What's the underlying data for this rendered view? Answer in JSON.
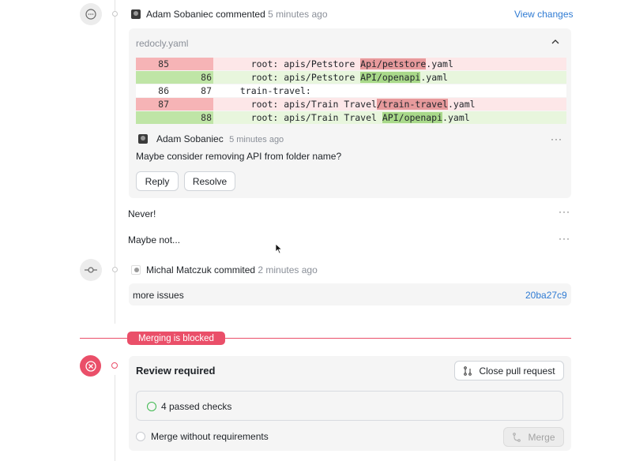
{
  "comment_event": {
    "author": "Adam Sobaniec",
    "action": "commented",
    "time": "5 minutes ago",
    "view_changes": "View changes"
  },
  "diff": {
    "filename": "redocly.yaml",
    "rows": [
      {
        "type": "del",
        "old": "85",
        "new": "",
        "prefix": "    root: apis/Petstore ",
        "highlight": "Api/petstore",
        "suffix": ".yaml"
      },
      {
        "type": "add",
        "old": "",
        "new": "86",
        "prefix": "    root: apis/Petstore ",
        "highlight": "API/openapi",
        "suffix": ".yaml"
      },
      {
        "type": "ctx",
        "old": "86",
        "new": "87",
        "prefix": "  train-travel:",
        "highlight": "",
        "suffix": ""
      },
      {
        "type": "del",
        "old": "87",
        "new": "",
        "prefix": "    root: apis/Train Travel",
        "highlight": "/train-travel",
        "suffix": ".yaml"
      },
      {
        "type": "add",
        "old": "",
        "new": "88",
        "prefix": "    root: apis/Train Travel ",
        "highlight": "API/openapi",
        "suffix": ".yaml"
      }
    ]
  },
  "review_comment": {
    "author": "Adam Sobaniec",
    "time": "5 minutes ago",
    "more": "···",
    "body": "Maybe consider removing API from folder name?",
    "reply": "Reply",
    "resolve": "Resolve"
  },
  "replies": [
    {
      "text": "Never!",
      "more": "···"
    },
    {
      "text": "Maybe not...",
      "more": "···"
    }
  ],
  "commit_event": {
    "author": "Michal Matczuk",
    "action": "commited",
    "time": "2 minutes ago",
    "message": "more issues",
    "sha": "20ba27c9"
  },
  "merge": {
    "blocked_label": "Merging is blocked",
    "review_required": "Review required",
    "close_pr": "Close pull request",
    "checks": "4 passed checks",
    "merge_without": "Merge without requirements",
    "merge_button": "Merge"
  },
  "colors": {
    "danger": "#ea4f69",
    "link": "#2f7bd3",
    "check_green": "#3fb950"
  }
}
